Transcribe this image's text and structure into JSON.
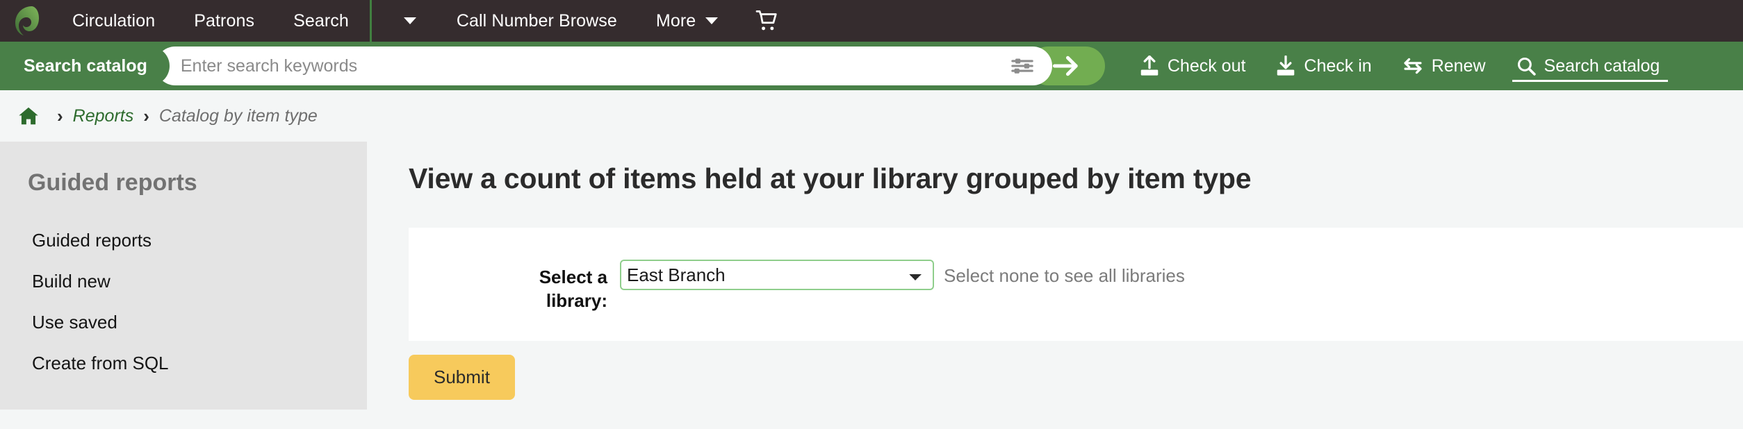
{
  "topnav": {
    "logo_name": "koha-leaf-logo",
    "items": [
      {
        "label": "Circulation",
        "name": "nav-circulation"
      },
      {
        "label": "Patrons",
        "name": "nav-patrons"
      },
      {
        "label": "Search",
        "name": "nav-search"
      }
    ],
    "dropdown_caret_label": "",
    "call_number_browse": "Call Number Browse",
    "more_label": "More",
    "cart_icon": "shopping-cart-icon",
    "background_color": "#352c2e",
    "separator_color": "#418040"
  },
  "searchbar": {
    "scope_label": "Search catalog",
    "placeholder": "Enter search keywords",
    "input_value": "",
    "filter_icon": "sliders-filter-icon",
    "submit_icon": "arrow-right-icon",
    "background_color": "#498048",
    "submit_button_color": "#72ad51",
    "tools": [
      {
        "label": "Check out",
        "icon": "upload-check-out-icon",
        "active": false
      },
      {
        "label": "Check in",
        "icon": "download-check-in-icon",
        "active": false
      },
      {
        "label": "Renew",
        "icon": "renew-arrows-icon",
        "active": false
      },
      {
        "label": "Search catalog",
        "icon": "magnifier-search-icon",
        "active": true
      }
    ]
  },
  "breadcrumb": {
    "home_icon": "home-icon",
    "separator": "›",
    "items": [
      {
        "label": "Reports",
        "link": true
      },
      {
        "label": "Catalog by item type",
        "link": false
      }
    ]
  },
  "sidebar": {
    "heading": "Guided reports",
    "background_color": "#e4e4e4",
    "items": [
      {
        "label": "Guided reports",
        "name": "sidebar-item-guided-reports"
      },
      {
        "label": "Build new",
        "name": "sidebar-item-build-new"
      },
      {
        "label": "Use saved",
        "name": "sidebar-item-use-saved"
      },
      {
        "label": "Create from SQL",
        "name": "sidebar-item-create-from-sql"
      }
    ]
  },
  "main": {
    "title": "View a count of items held at your library grouped by item type",
    "form": {
      "label": "Select a library:",
      "select_value": "East Branch",
      "select_options": [
        "East Branch"
      ],
      "hint": "Select none to see all libraries",
      "select_border_color": "#8fce8c"
    },
    "submit_label": "Submit",
    "submit_color": "#f7ca5c"
  }
}
